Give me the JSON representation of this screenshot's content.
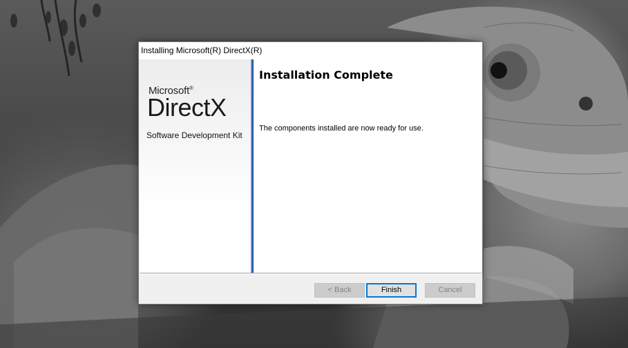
{
  "window": {
    "title": "Installing Microsoft(R) DirectX(R)"
  },
  "branding": {
    "microsoft": "Microsoft",
    "registered": "®",
    "directx": "DirectX",
    "sdk": "Software Development Kit"
  },
  "main": {
    "title": "Installation Complete",
    "message": "The components installed are now ready for use."
  },
  "buttons": {
    "back": "< Back",
    "finish": "Finish",
    "cancel": "Cancel"
  },
  "colors": {
    "accent_bar": "#2f5fb0",
    "default_button_border": "#0078d7"
  }
}
